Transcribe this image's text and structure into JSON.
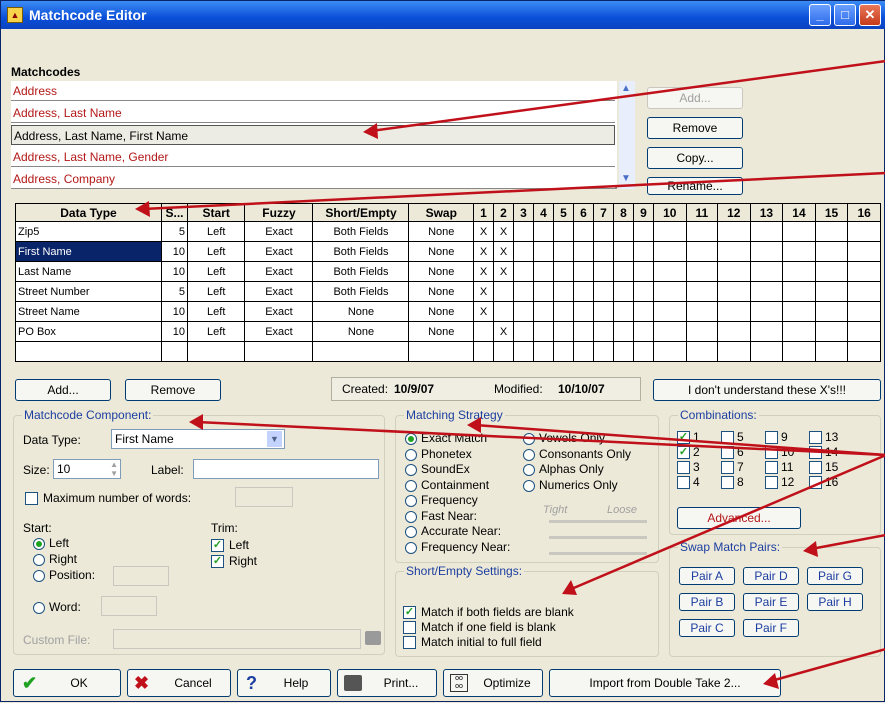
{
  "window": {
    "title": "Matchcode Editor"
  },
  "matchcodes": {
    "label": "Matchcodes",
    "items": [
      "Address",
      "Address, Last Name",
      "Address, Last Name, First Name",
      "Address, Last Name, Gender",
      "Address, Company"
    ],
    "selected_index": 2,
    "buttons": {
      "add": "Add...",
      "remove": "Remove",
      "copy": "Copy...",
      "rename": "Rename..."
    }
  },
  "grid": {
    "columns": [
      "Data Type",
      "S...",
      "Start",
      "Fuzzy",
      "Short/Empty",
      "Swap",
      "1",
      "2",
      "3",
      "4",
      "5",
      "6",
      "7",
      "8",
      "9",
      "10",
      "11",
      "12",
      "13",
      "14",
      "15",
      "16"
    ],
    "rows": [
      {
        "type": "Zip5",
        "size": "5",
        "start": "Left",
        "fuzzy": "Exact",
        "short_empty": "Both Fields",
        "swap": "None",
        "c1": "X",
        "c2": "X"
      },
      {
        "type": "First Name",
        "size": "10",
        "start": "Left",
        "fuzzy": "Exact",
        "short_empty": "Both Fields",
        "swap": "None",
        "c1": "X",
        "c2": "X"
      },
      {
        "type": "Last Name",
        "size": "10",
        "start": "Left",
        "fuzzy": "Exact",
        "short_empty": "Both Fields",
        "swap": "None",
        "c1": "X",
        "c2": "X"
      },
      {
        "type": "Street Number",
        "size": "5",
        "start": "Left",
        "fuzzy": "Exact",
        "short_empty": "Both Fields",
        "swap": "None",
        "c1": "X",
        "c2": ""
      },
      {
        "type": "Street Name",
        "size": "10",
        "start": "Left",
        "fuzzy": "Exact",
        "short_empty": "None",
        "swap": "None",
        "c1": "X",
        "c2": ""
      },
      {
        "type": "PO Box",
        "size": "10",
        "start": "Left",
        "fuzzy": "Exact",
        "short_empty": "None",
        "swap": "None",
        "c1": "",
        "c2": "X"
      }
    ],
    "add": "Add...",
    "remove": "Remove",
    "created_label": "Created:",
    "created": "10/9/07",
    "modified_label": "Modified:",
    "modified": "10/10/07",
    "help_button": "I don't understand these X's!!!"
  },
  "component": {
    "title": "Matchcode Component:",
    "data_type_label": "Data Type:",
    "data_type": "First Name",
    "size_label": "Size:",
    "size": "10",
    "label_label": "Label:",
    "label_value": "",
    "max_words": "Maximum number of words:",
    "start_label": "Start:",
    "start_left": "Left",
    "start_right": "Right",
    "start_position": "Position:",
    "start_word": "Word:",
    "trim_label": "Trim:",
    "trim_left": "Left",
    "trim_right": "Right",
    "custom_file": "Custom File:"
  },
  "strategy": {
    "title": "Matching Strategy",
    "options_left": [
      "Exact Match",
      "Phonetex",
      "SoundEx",
      "Containment",
      "Frequency",
      "Fast Near:",
      "Accurate Near:",
      "Frequency Near:"
    ],
    "options_right": [
      "Vowels Only",
      "Consonants Only",
      "Alphas Only",
      "Numerics Only"
    ],
    "tight": "Tight",
    "loose": "Loose"
  },
  "short_empty": {
    "title": "Short/Empty Settings:",
    "options": [
      "Match if both fields are blank",
      "Match if one field is blank",
      "Match initial to full field"
    ],
    "checked": [
      true,
      false,
      false
    ]
  },
  "combinations": {
    "title": "Combinations:",
    "items": [
      "1",
      "2",
      "3",
      "4",
      "5",
      "6",
      "7",
      "8",
      "9",
      "10",
      "11",
      "12",
      "13",
      "14",
      "15",
      "16"
    ],
    "checked": [
      "1",
      "2"
    ],
    "advanced": "Advanced..."
  },
  "swap_pairs": {
    "title": "Swap Match Pairs:",
    "pairs": [
      "Pair A",
      "Pair D",
      "Pair G",
      "Pair B",
      "Pair E",
      "Pair H",
      "Pair C",
      "Pair F"
    ]
  },
  "footer": {
    "ok": "OK",
    "cancel": "Cancel",
    "help": "Help",
    "print": "Print...",
    "optimize": "Optimize",
    "import": "Import from Double Take 2..."
  },
  "colors": {
    "red_item": "#b41818",
    "title_blue": "#0a4fd8",
    "annotation_red": "#c0101a",
    "check_green": "#21a121"
  }
}
